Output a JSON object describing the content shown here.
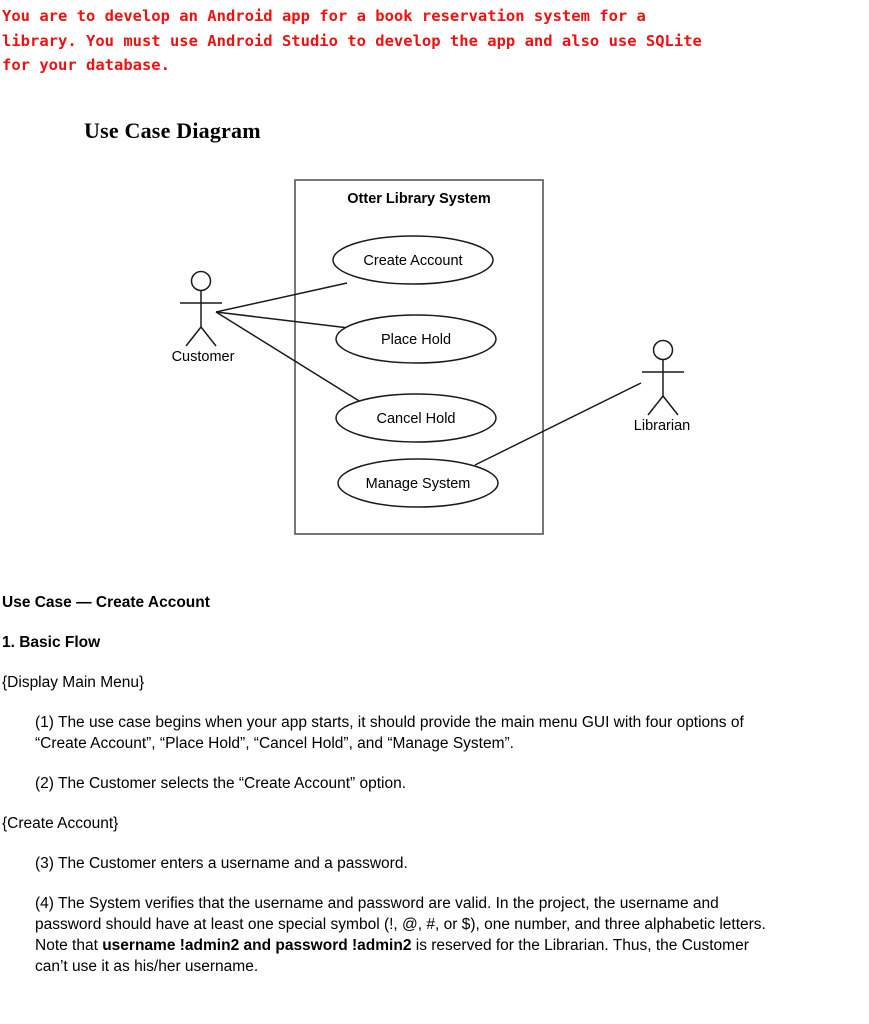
{
  "prompt": {
    "text": "You are to develop an Android app for a book reservation system for a\nlibrary. You must use Android Studio to develop the app and also use SQLite\nfor your database.",
    "color": "#ee1111"
  },
  "section_title": "Use Case Diagram",
  "diagram": {
    "system_boundary_label": "Otter Library System",
    "use_cases": [
      {
        "label": "Create Account"
      },
      {
        "label": "Place Hold"
      },
      {
        "label": "Cancel Hold"
      },
      {
        "label": "Manage System"
      }
    ],
    "actors": [
      {
        "label": "Customer"
      },
      {
        "label": "Librarian"
      }
    ],
    "associations": [
      {
        "actor": "Customer",
        "use_case": "Create Account"
      },
      {
        "actor": "Customer",
        "use_case": "Place Hold"
      },
      {
        "actor": "Customer",
        "use_case": "Cancel Hold"
      },
      {
        "actor": "Librarian",
        "use_case": "Manage System"
      }
    ]
  },
  "document": {
    "use_case_heading": "Use Case — Create Account",
    "flow_heading": "1. Basic Flow",
    "brace_display_main_menu": "{Display Main Menu}",
    "step_1": "(1) The use case begins when your app starts, it should provide the main menu GUI with four options of “Create Account”, “Place Hold”, “Cancel Hold”, and “Manage System”.",
    "step_2": "(2) The Customer selects the “Create Account” option.",
    "brace_create_account": "{Create Account}",
    "step_3": "(3) The Customer enters a username and a password.",
    "step_4_part1": "(4) The System verifies that the username and password are valid. In the project, the username and password should have at least one special symbol (!, @, #, or $), one number, and three alphabetic letters. Note that ",
    "step_4_bold": "username !admin2 and password !admin2",
    "step_4_part2": " is reserved for the Librarian. Thus, the Customer can’t use it as his/her username."
  }
}
